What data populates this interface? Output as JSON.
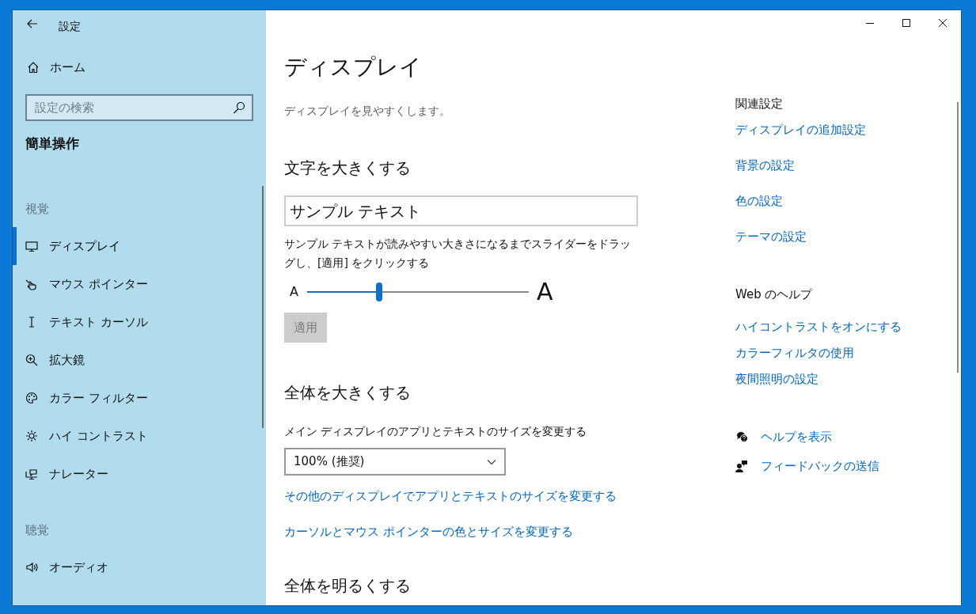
{
  "window": {
    "title": "設定"
  },
  "sidebar": {
    "home": {
      "label": "ホーム"
    },
    "search": {
      "placeholder": "設定の検索"
    },
    "section_title": "簡単操作",
    "groups": [
      {
        "heading": "視覚",
        "items": [
          {
            "label": "ディスプレイ",
            "selected": true
          },
          {
            "label": "マウス ポインター",
            "selected": false
          },
          {
            "label": "テキスト カーソル",
            "selected": false
          },
          {
            "label": "拡大鏡",
            "selected": false
          },
          {
            "label": "カラー フィルター",
            "selected": false
          },
          {
            "label": "ハイ コントラスト",
            "selected": false
          },
          {
            "label": "ナレーター",
            "selected": false
          }
        ]
      },
      {
        "heading": "聴覚",
        "items": [
          {
            "label": "オーディオ",
            "selected": false
          }
        ]
      }
    ]
  },
  "main": {
    "title": "ディスプレイ",
    "subtitle": "ディスプレイを見やすくします。",
    "text_size": {
      "heading": "文字を大きくする",
      "sample_text": "サンプル テキスト",
      "description": "サンプル テキストが読みやすい大きさになるまでスライダーをドラッグし、[適用] をクリックする",
      "small_label": "A",
      "large_label": "A",
      "level": 0.325,
      "apply_button": {
        "label": "適用",
        "disabled": true
      }
    },
    "scale": {
      "heading": "全体を大きくする",
      "label": "メイン ディスプレイのアプリとテキストのサイズを変更する",
      "dropdown_value": "100% (推奨)",
      "links": [
        "その他のディスプレイでアプリとテキストのサイズを変更する",
        "カーソルとマウス ポインターの色とサイズを変更する"
      ]
    },
    "brightness": {
      "heading": "全体を明るくする"
    }
  },
  "related": {
    "heading": "関連設定",
    "links": [
      "ディスプレイの追加設定",
      "背景の設定",
      "色の設定",
      "テーマの設定"
    ]
  },
  "web_help": {
    "heading": "Web のヘルプ",
    "links": [
      "ハイコントラストをオンにする",
      "カラーフィルタの使用",
      "夜間照明の設定"
    ]
  },
  "support_links": [
    "ヘルプを表示",
    "フィードバックの送信"
  ]
}
